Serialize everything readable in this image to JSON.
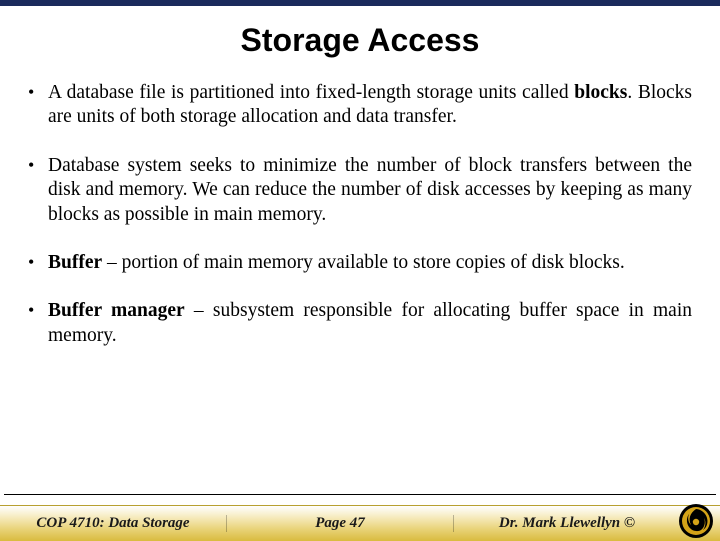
{
  "title": "Storage Access",
  "bullets": [
    {
      "pre": "A database file is partitioned into fixed-length storage units called ",
      "bold": "blocks",
      "post": ".  Blocks are units of both storage allocation and data transfer."
    },
    {
      "pre": "Database system seeks to minimize the number of block transfers between the disk and memory.  We can reduce the number of disk accesses by keeping as many blocks as possible in main memory.",
      "bold": "",
      "post": ""
    },
    {
      "pre": "",
      "bold": "Buffer",
      "post": " – portion of main memory available to store copies of disk blocks."
    },
    {
      "pre": "",
      "bold": "Buffer manager",
      "post": " – subsystem responsible for allocating buffer space in main memory."
    }
  ],
  "footer": {
    "course": "COP 4710: Data Storage",
    "page": "Page 47",
    "author": "Dr. Mark Llewellyn ©"
  }
}
